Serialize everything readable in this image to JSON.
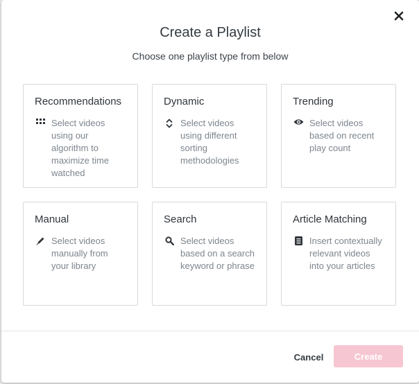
{
  "dialog": {
    "title": "Create a Playlist",
    "subtitle": "Choose one playlist type from below",
    "close_icon": "close-icon"
  },
  "cards": [
    {
      "title": "Recommendations",
      "icon": "grid-icon",
      "description": "Select videos using our algorithm to maximize time watched"
    },
    {
      "title": "Dynamic",
      "icon": "sort-icon",
      "description": "Select videos using different sorting methodologies"
    },
    {
      "title": "Trending",
      "icon": "eye-icon",
      "description": "Select videos based on recent play count"
    },
    {
      "title": "Manual",
      "icon": "pencil-icon",
      "description": "Select videos manually from your library"
    },
    {
      "title": "Search",
      "icon": "search-icon",
      "description": "Select videos based on a search keyword or phrase"
    },
    {
      "title": "Article Matching",
      "icon": "document-icon",
      "description": "Insert contextually relevant videos into your articles"
    }
  ],
  "footer": {
    "cancel_label": "Cancel",
    "create_label": "Create"
  },
  "colors": {
    "create_button_bg": "#f7c6d3",
    "card_border": "#d6d9dc",
    "description_text": "#7d858d"
  }
}
